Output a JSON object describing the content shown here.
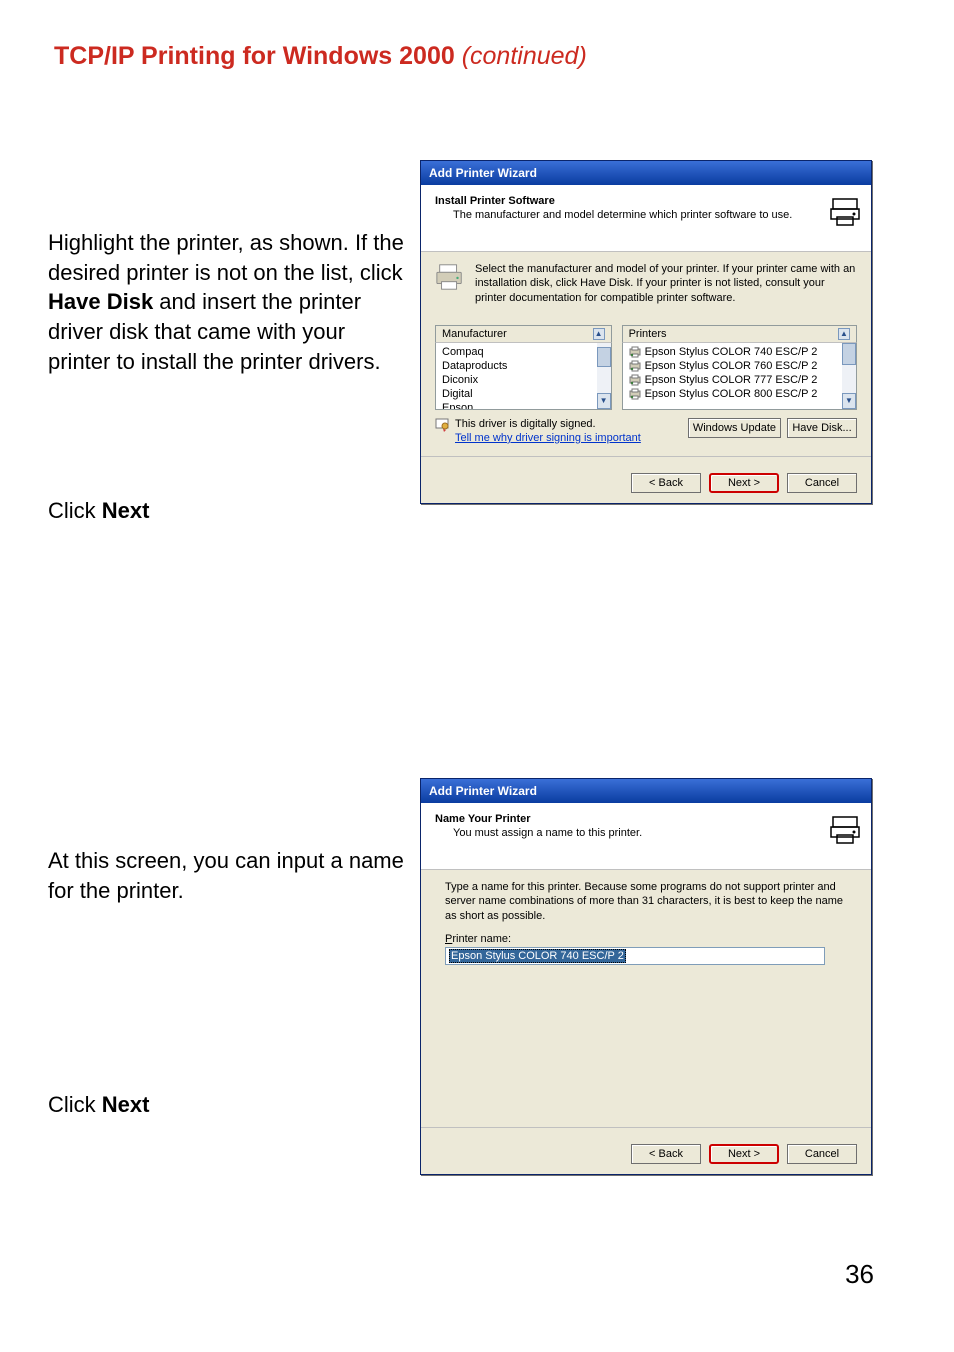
{
  "header": {
    "title_main": "TCP/IP Printing for Windows 2000 ",
    "title_cont": "(continued)"
  },
  "instructions": {
    "para1_pre": "Highlight the printer, as shown. If the desired printer is not on the list, click ",
    "para1_bold": "Have Disk",
    "para1_post": " and insert the printer driver disk that came with your printer to install the printer drivers.",
    "click1_pre": "Click ",
    "click1_bold": "Next",
    "para2": "At this screen, you can input a name for the printer.",
    "click2_pre": "Click ",
    "click2_bold": "Next"
  },
  "dialog1": {
    "title": "Add Printer Wizard",
    "header_title": "Install Printer Software",
    "header_sub": "The manufacturer and model determine which printer software to use.",
    "body_text": "Select the manufacturer and model of your printer. If your printer came with an installation disk, click Have Disk. If your printer is not listed, consult your printer documentation for compatible printer software.",
    "col_mfg": "Manufacturer",
    "col_prt": "Printers",
    "mfg_items": [
      "Compaq",
      "Dataproducts",
      "Diconix",
      "Digital",
      "Epson"
    ],
    "prt_items": [
      "Epson Stylus COLOR 740 ESC/P 2",
      "Epson Stylus COLOR 760 ESC/P 2",
      "Epson Stylus COLOR 777 ESC/P 2",
      "Epson Stylus COLOR 800 ESC/P 2"
    ],
    "driver_signed": "This driver is digitally signed.",
    "driver_link": "Tell me why driver signing is important",
    "btn_win_update": "Windows Update",
    "btn_have_disk": "Have Disk...",
    "btn_back": "< Back",
    "btn_next": "Next >",
    "btn_cancel": "Cancel"
  },
  "dialog2": {
    "title": "Add Printer Wizard",
    "header_title": "Name Your Printer",
    "header_sub": "You must assign a name to this printer.",
    "hint": "Type a name for this printer. Because some programs do not support printer and server name combinations of more than 31 characters, it is best to keep the name as short as possible.",
    "input_label_u": "P",
    "input_label_rest": "rinter name:",
    "input_value": "Epson Stylus COLOR 740 ESC/P 2",
    "btn_back": "< Back",
    "btn_next": "Next >",
    "btn_cancel": "Cancel"
  },
  "page_number": "36"
}
